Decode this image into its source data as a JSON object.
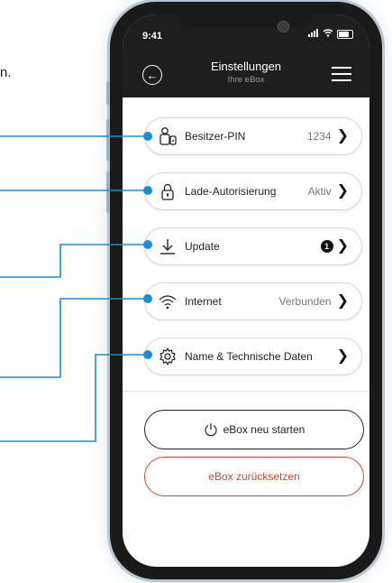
{
  "edge_text": "n.",
  "status_bar": {
    "time": "9:41"
  },
  "header": {
    "title": "Einstellungen",
    "subtitle": "Ihre eBox"
  },
  "settings": [
    {
      "label": "Besitzer-PIN",
      "value": "1234",
      "icon": "owner-pin-icon"
    },
    {
      "label": "Lade-Autorisierung",
      "value": "Aktiv",
      "icon": "lock-icon"
    },
    {
      "label": "Update",
      "badge": "1",
      "icon": "download-icon"
    },
    {
      "label": "Internet",
      "value": "Verbunden",
      "icon": "wifi-icon"
    },
    {
      "label": "Name & Technische Daten",
      "icon": "gear-icon"
    }
  ],
  "actions": {
    "restart": "eBox neu starten",
    "reset": "eBox zurücksetzen"
  },
  "colors": {
    "accent": "#1b8ed0",
    "danger": "#c9492f",
    "header_bg": "#1e1e1e"
  }
}
